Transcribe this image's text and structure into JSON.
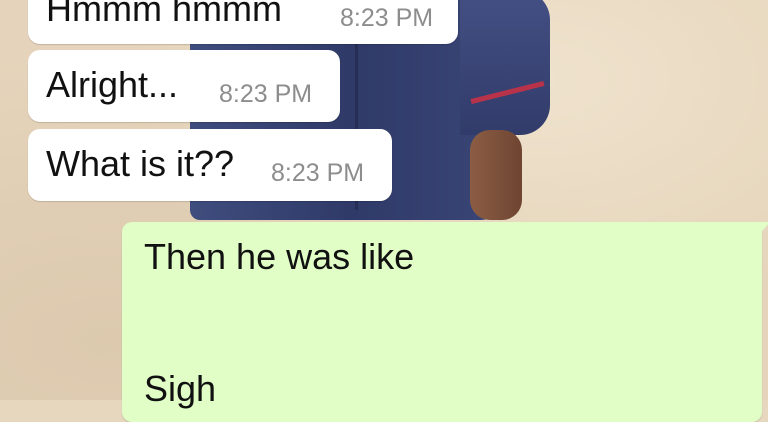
{
  "chat": {
    "messages": [
      {
        "direction": "incoming",
        "text": "Hmmm hmmm",
        "time": "8:23 PM"
      },
      {
        "direction": "incoming",
        "text": "Alright...",
        "time": "8:23 PM"
      },
      {
        "direction": "incoming",
        "text": "What is it??",
        "time": "8:23 PM"
      },
      {
        "direction": "outgoing",
        "lines": [
          "Then he was like",
          "Sigh"
        ]
      }
    ]
  },
  "colors": {
    "incoming_bubble": "#ffffff",
    "outgoing_bubble": "#e1fec6",
    "timestamp": "#8d8d8d"
  }
}
